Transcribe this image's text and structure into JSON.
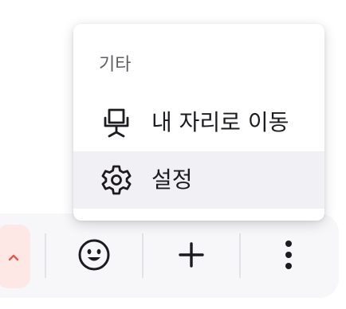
{
  "menu": {
    "section_title": "기타",
    "items": [
      {
        "label": "내 자리로 이동",
        "icon": "chair-icon"
      },
      {
        "label": "설정",
        "icon": "gear-icon"
      }
    ]
  },
  "toolbar": {
    "buttons": [
      {
        "icon": "chevron-up-icon",
        "color": "#e8554a"
      },
      {
        "icon": "smiley-icon"
      },
      {
        "icon": "plus-icon"
      },
      {
        "icon": "more-vertical-icon"
      }
    ]
  },
  "colors": {
    "menu_highlight": "#f1f0f4",
    "toolbar_bg": "#f7f6f8",
    "caret_bg": "#fde8e6",
    "caret": "#e8554a",
    "text": "#1d1b20"
  }
}
